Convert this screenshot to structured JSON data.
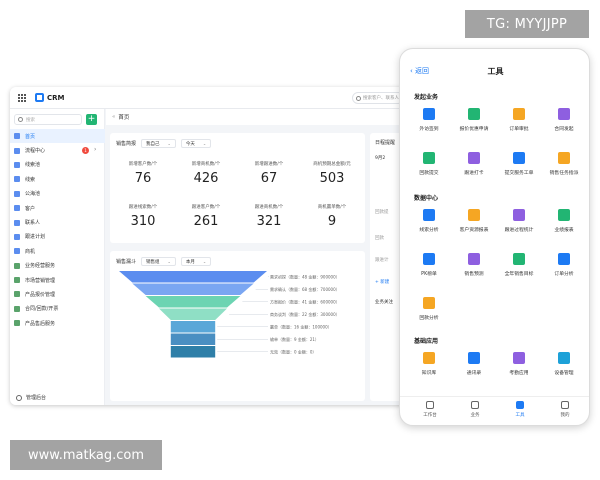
{
  "watermarks": {
    "top": "TG: MYYJJPP",
    "bottom": "www.matkag.com"
  },
  "colors": {
    "accent": "#1d7af3",
    "green": "#22b573",
    "badge": "#f04a3e"
  },
  "desktop": {
    "app_name": "CRM",
    "top_search_placeholder": "搜索客户、联系人",
    "sidebar": {
      "search_placeholder": "搜索",
      "items": [
        {
          "label": "首页",
          "icon": "home-icon"
        },
        {
          "label": "流程中心",
          "icon": "flow-icon",
          "badge": "1"
        },
        {
          "label": "线索池",
          "icon": "clue-pool-icon"
        },
        {
          "label": "线索",
          "icon": "clue-icon"
        },
        {
          "label": "公海池",
          "icon": "sea-pool-icon"
        },
        {
          "label": "客户",
          "icon": "customer-icon"
        },
        {
          "label": "联系人",
          "icon": "contact-icon"
        },
        {
          "label": "跟进计划",
          "icon": "plan-icon"
        },
        {
          "label": "商机",
          "icon": "opportunity-icon"
        },
        {
          "label": "业务经营服务",
          "icon": "folder-icon"
        },
        {
          "label": "市场营销管理",
          "icon": "folder-icon"
        },
        {
          "label": "产品报价管理",
          "icon": "folder-icon"
        },
        {
          "label": "合同/回款/开票",
          "icon": "folder-icon"
        },
        {
          "label": "产品售后服务",
          "icon": "folder-icon"
        }
      ],
      "footer": "管理后台"
    },
    "breadcrumb": "首页",
    "kpi_card": {
      "title": "销售简报",
      "filter_owner": "我自己",
      "filter_period": "今天",
      "kpis": [
        {
          "label": "新增客户数/个",
          "value": "76"
        },
        {
          "label": "新增商机数/个",
          "value": "426"
        },
        {
          "label": "新增跟进数/个",
          "value": "67"
        },
        {
          "label": "商机预期总金额/元",
          "value": "503"
        },
        {
          "label": "跟进线索数/个",
          "value": "310"
        },
        {
          "label": "跟进客户数/个",
          "value": "261"
        },
        {
          "label": "跟进商机数/个",
          "value": "321"
        },
        {
          "label": "商机赢单数/个",
          "value": "9"
        }
      ]
    },
    "funnel_card": {
      "title": "销售漏斗",
      "filter_type": "销售组",
      "filter_period": "本月",
      "stages": [
        {
          "label": "需求初探（数量：48 金额：900000）",
          "fraction": 1.0,
          "color": "#5b8def"
        },
        {
          "label": "需求确认（数量：68 金额：700000）",
          "fraction": 0.82,
          "color": "#7aa6f2"
        },
        {
          "label": "方案报价（数量：41 金额：600000）",
          "fraction": 0.64,
          "color": "#6cd4b2"
        },
        {
          "label": "商务谈判（数量：22 金额：300000）",
          "fraction": 0.46,
          "color": "#8fdfc5"
        },
        {
          "label": "赢单（数量：16 金额：100000）",
          "fraction": 0.3,
          "color": "#5aa7d8"
        },
        {
          "label": "输单（数量：9 金额：21）",
          "fraction": 0.3,
          "color": "#4a8fc2"
        },
        {
          "label": "无效（数量：0 金额：0）",
          "fraction": 0.3,
          "color": "#2f7fa8"
        }
      ]
    },
    "right_card": {
      "title": "日程提醒",
      "date": "9月2",
      "lines": [
        "回款提",
        "回款",
        "跟进计",
        "+ 新建",
        "业务关注"
      ]
    }
  },
  "phone": {
    "back": "返回",
    "title": "工具",
    "sections": [
      {
        "title": "发起业务",
        "tools": [
          {
            "label": "外访签到",
            "icon": "checkin-icon",
            "color": "#1d7af3"
          },
          {
            "label": "报价优惠申请",
            "icon": "discount-icon",
            "color": "#22b573"
          },
          {
            "label": "订单审批",
            "icon": "order-approve-icon",
            "color": "#f5a623"
          },
          {
            "label": "合同发起",
            "icon": "contract-icon",
            "color": "#8e5fe0"
          },
          {
            "label": "回款提交",
            "icon": "payment-icon",
            "color": "#22b573"
          },
          {
            "label": "跟进打卡",
            "icon": "followup-icon",
            "color": "#8e5fe0"
          },
          {
            "label": "提交服务工单",
            "icon": "service-ticket-icon",
            "color": "#1d7af3"
          },
          {
            "label": "销售任务指派",
            "icon": "task-icon",
            "color": "#f5a623"
          }
        ]
      },
      {
        "title": "数据中心",
        "tools": [
          {
            "label": "线索分析",
            "icon": "clue-analysis-icon",
            "color": "#1d7af3"
          },
          {
            "label": "客户资源报表",
            "icon": "customer-report-icon",
            "color": "#f5a623"
          },
          {
            "label": "跟进过程统计",
            "icon": "process-stat-icon",
            "color": "#8e5fe0"
          },
          {
            "label": "业绩报表",
            "icon": "performance-icon",
            "color": "#22b573"
          },
          {
            "label": "PK榜单",
            "icon": "pk-rank-icon",
            "color": "#1d7af3"
          },
          {
            "label": "销售预测",
            "icon": "forecast-icon",
            "color": "#8e5fe0"
          },
          {
            "label": "全年销售目标",
            "icon": "target-icon",
            "color": "#22b573"
          },
          {
            "label": "订单分析",
            "icon": "order-analysis-icon",
            "color": "#1d7af3"
          },
          {
            "label": "回款分析",
            "icon": "payment-analysis-icon",
            "color": "#f5a623"
          }
        ]
      },
      {
        "title": "基础应用",
        "tools": [
          {
            "label": "知识库",
            "icon": "knowledge-icon",
            "color": "#f5a623"
          },
          {
            "label": "通讯录",
            "icon": "contacts-icon",
            "color": "#1d7af3"
          },
          {
            "label": "考勤应用",
            "icon": "attendance-icon",
            "color": "#8e5fe0"
          },
          {
            "label": "设备管理",
            "icon": "device-icon",
            "color": "#1da1d8"
          }
        ]
      }
    ],
    "tabs": [
      {
        "label": "工作台",
        "icon": "workbench-icon",
        "active": false
      },
      {
        "label": "业务",
        "icon": "business-icon",
        "active": false
      },
      {
        "label": "工具",
        "icon": "tools-icon",
        "active": true
      },
      {
        "label": "我的",
        "icon": "profile-icon",
        "active": false
      }
    ]
  }
}
